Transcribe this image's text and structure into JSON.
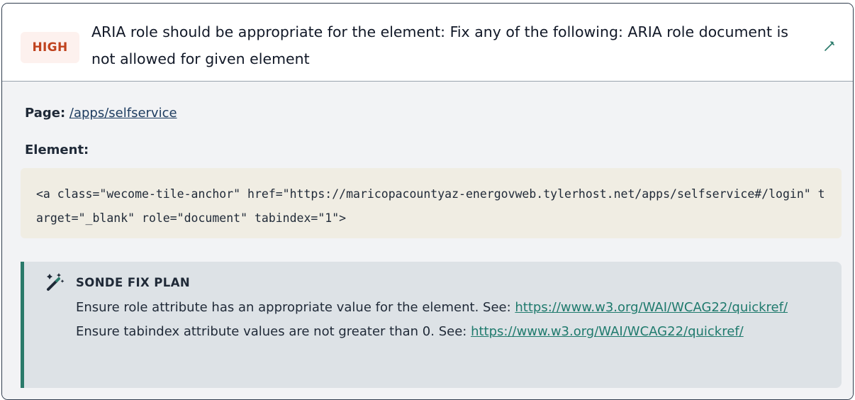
{
  "issue": {
    "severity": "HIGH",
    "title": "ARIA role should be appropriate for the element: Fix any of the following: ARIA role document is not allowed for given element",
    "header_icon": "wand-icon"
  },
  "details": {
    "page_label": "Page:",
    "page_link": "/apps/selfservice",
    "element_label": "Element:",
    "element_code": "<a class=\"wecome-tile-anchor\" href=\"https://maricopacountyaz-energovweb.tylerhost.net/apps/selfservice#/login\" target=\"_blank\" role=\"document\" tabindex=\"1\">"
  },
  "fix_plan": {
    "icon": "magic-wand-icon",
    "heading": "SONDE FIX PLAN",
    "text_1": "Ensure role attribute has an appropriate value for the element. See: ",
    "link_1": "https://www.w3.org/WAI/WCAG22/quickref/",
    "text_2": " Ensure tabindex attribute values are not greater than 0. See: ",
    "link_2": "https://www.w3.org/WAI/WCAG22/quickref/"
  },
  "colors": {
    "severity_text": "#c0431f",
    "severity_bg": "#fdf1ee",
    "accent": "#2a7a6a",
    "code_bg": "#f0ede3"
  }
}
